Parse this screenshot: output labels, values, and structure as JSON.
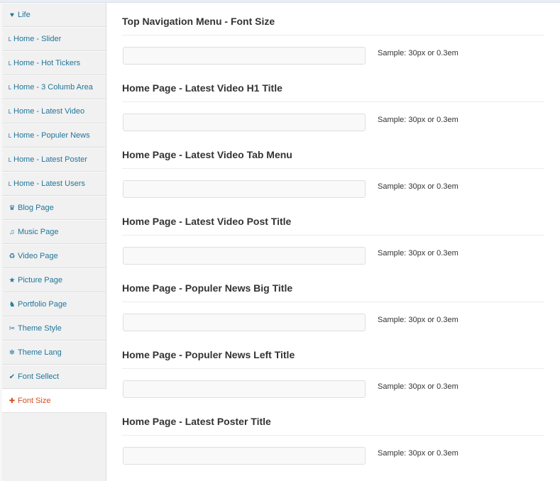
{
  "sidebar": {
    "items": [
      {
        "icon": "heart-icon",
        "glyph": "♥",
        "label": "Life",
        "sub": false,
        "active": false
      },
      {
        "icon": "sub-indent-icon",
        "glyph": "L",
        "label": "Home - Slider",
        "sub": true,
        "active": false
      },
      {
        "icon": "sub-indent-icon",
        "glyph": "L",
        "label": "Home - Hot Tickers",
        "sub": true,
        "active": false
      },
      {
        "icon": "sub-indent-icon",
        "glyph": "L",
        "label": "Home - 3 Columb Area",
        "sub": true,
        "active": false
      },
      {
        "icon": "sub-indent-icon",
        "glyph": "L",
        "label": "Home - Latest Video",
        "sub": true,
        "active": false
      },
      {
        "icon": "sub-indent-icon",
        "glyph": "L",
        "label": "Home - Populer News",
        "sub": true,
        "active": false
      },
      {
        "icon": "sub-indent-icon",
        "glyph": "L",
        "label": "Home - Latest Poster",
        "sub": true,
        "active": false
      },
      {
        "icon": "sub-indent-icon",
        "glyph": "L",
        "label": "Home - Latest Users",
        "sub": true,
        "active": false
      },
      {
        "icon": "crown-icon",
        "glyph": "♛",
        "label": "Blog Page",
        "sub": false,
        "active": false
      },
      {
        "icon": "music-note-icon",
        "glyph": "♫",
        "label": "Music Page",
        "sub": false,
        "active": false
      },
      {
        "icon": "recycle-icon",
        "glyph": "♻",
        "label": "Video Page",
        "sub": false,
        "active": false
      },
      {
        "icon": "star-icon",
        "glyph": "★",
        "label": "Picture Page",
        "sub": false,
        "active": false
      },
      {
        "icon": "chess-knight-icon",
        "glyph": "♞",
        "label": "Portfolio Page",
        "sub": false,
        "active": false
      },
      {
        "icon": "scissors-icon",
        "glyph": "✂",
        "label": "Theme Style",
        "sub": false,
        "active": false
      },
      {
        "icon": "snowflake-icon",
        "glyph": "❄",
        "label": "Theme Lang",
        "sub": false,
        "active": false
      },
      {
        "icon": "checkmark-icon",
        "glyph": "✔",
        "label": "Font Sellect",
        "sub": false,
        "active": false
      },
      {
        "icon": "plus-icon",
        "glyph": "✚",
        "label": "Font Size",
        "sub": false,
        "active": true
      }
    ]
  },
  "sections": [
    {
      "title": "Top Navigation Menu - Font Size",
      "value": "",
      "placeholder": "",
      "hint": "Sample: 30px or 0.3em"
    },
    {
      "title": "Home Page - Latest Video H1 Title",
      "value": "",
      "placeholder": "",
      "hint": "Sample: 30px or 0.3em"
    },
    {
      "title": "Home Page - Latest Video Tab Menu",
      "value": "",
      "placeholder": "",
      "hint": "Sample: 30px or 0.3em"
    },
    {
      "title": "Home Page - Latest Video Post Title",
      "value": "",
      "placeholder": "",
      "hint": "Sample: 30px or 0.3em"
    },
    {
      "title": "Home Page - Populer News Big Title",
      "value": "",
      "placeholder": "",
      "hint": "Sample: 30px or 0.3em"
    },
    {
      "title": "Home Page - Populer News Left Title",
      "value": "",
      "placeholder": "",
      "hint": "Sample: 30px or 0.3em"
    },
    {
      "title": "Home Page - Latest Poster Title",
      "value": "",
      "placeholder": "",
      "hint": "Sample: 30px or 0.3em"
    }
  ],
  "colors": {
    "link": "#21759b",
    "active": "#d54e21",
    "heading": "#333333",
    "sidebar_bg": "#f1f1f1"
  }
}
